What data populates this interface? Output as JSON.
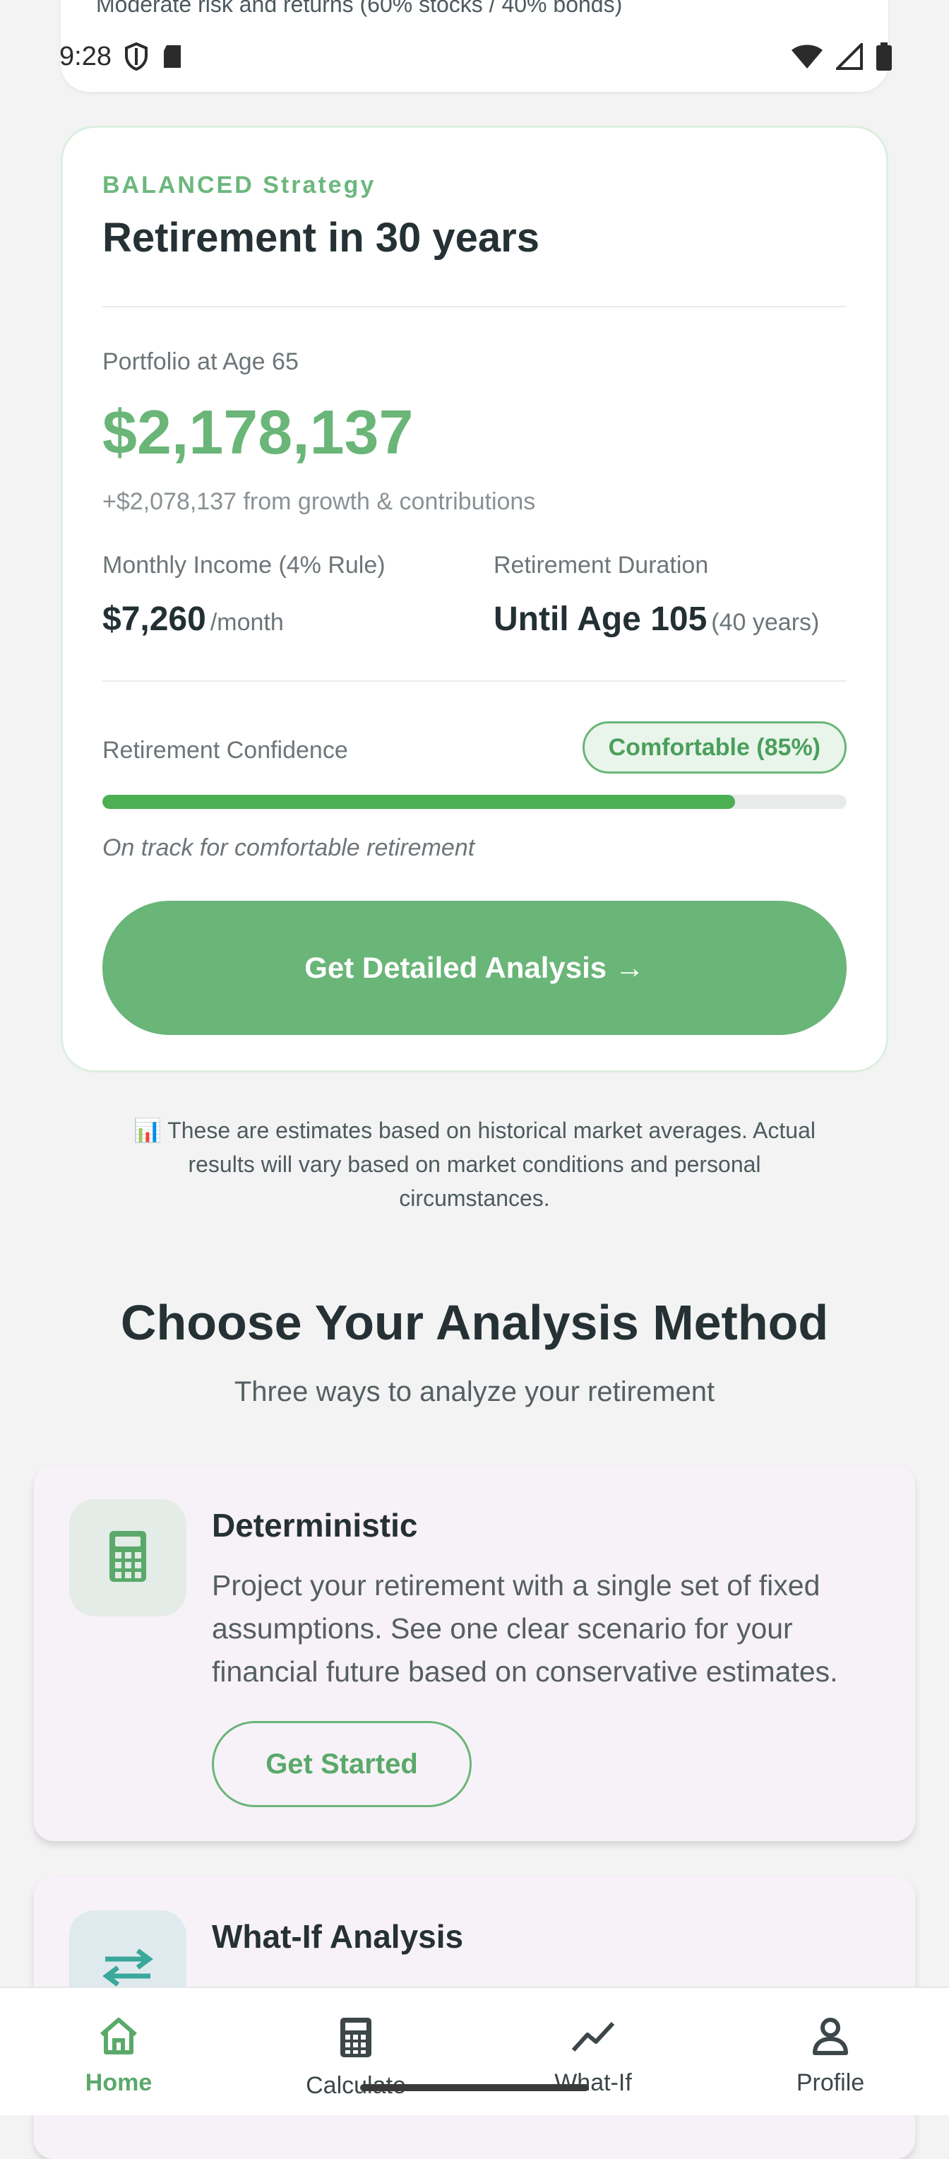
{
  "top_card": {
    "cut_text": "Moderate risk and returns (60% stocks / 40% bonds)"
  },
  "status_bar": {
    "time": "9:28",
    "icons": [
      "shield-icon",
      "sd-card-icon",
      "wifi-icon",
      "signal-icon",
      "battery-icon"
    ]
  },
  "strategy": {
    "kicker": "BALANCED Strategy",
    "title": "Retirement in 30 years",
    "portfolio_label": "Portfolio at Age 65",
    "portfolio_value": "$2,178,137",
    "growth_note": "+$2,078,137 from growth & contributions",
    "income_label": "Monthly Income (4% Rule)",
    "income_value": "$7,260",
    "income_unit": "/month",
    "duration_label": "Retirement Duration",
    "duration_value": "Until Age 105",
    "duration_unit": "(40 years)",
    "confidence_label": "Retirement Confidence",
    "confidence_badge": "Comfortable (85%)",
    "confidence_percent": 85,
    "track_note": "On track for comfortable retirement",
    "button_label": "Get Detailed Analysis →"
  },
  "disclaimer": {
    "icon": "📊",
    "text": "These are estimates based on historical market averages. Actual results will vary based on market conditions and personal circumstances."
  },
  "methods": {
    "title": "Choose Your Analysis Method",
    "subtitle": "Three ways to analyze your retirement",
    "items": [
      {
        "title": "Deterministic",
        "description": "Project your retirement with a single set of fixed assumptions. See one clear scenario for your financial future based on conservative estimates.",
        "button": "Get Started",
        "icon": "calculator-icon"
      },
      {
        "title": "What-If Analysis",
        "icon": "compare-arrows-icon"
      }
    ]
  },
  "nav": {
    "items": [
      {
        "label": "Home",
        "icon": "home-icon",
        "active": true
      },
      {
        "label": "Calculate",
        "icon": "calculator-icon",
        "active": false
      },
      {
        "label": "What-If",
        "icon": "trend-icon",
        "active": false
      },
      {
        "label": "Profile",
        "icon": "person-icon",
        "active": false
      }
    ]
  },
  "colors": {
    "accent": "#6ab578",
    "progress": "#4caf54",
    "background": "#f3f3f3",
    "method_card": "#f7f2f8"
  }
}
